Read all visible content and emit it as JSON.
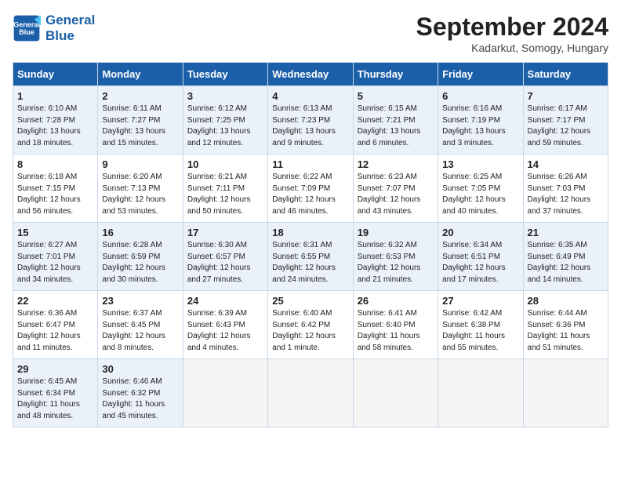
{
  "header": {
    "logo_line1": "General",
    "logo_line2": "Blue",
    "month_year": "September 2024",
    "location": "Kadarkut, Somogy, Hungary"
  },
  "weekdays": [
    "Sunday",
    "Monday",
    "Tuesday",
    "Wednesday",
    "Thursday",
    "Friday",
    "Saturday"
  ],
  "weeks": [
    [
      {
        "day": "1",
        "sunrise": "6:10 AM",
        "sunset": "7:28 PM",
        "daylight": "13 hours and 18 minutes."
      },
      {
        "day": "2",
        "sunrise": "6:11 AM",
        "sunset": "7:27 PM",
        "daylight": "13 hours and 15 minutes."
      },
      {
        "day": "3",
        "sunrise": "6:12 AM",
        "sunset": "7:25 PM",
        "daylight": "13 hours and 12 minutes."
      },
      {
        "day": "4",
        "sunrise": "6:13 AM",
        "sunset": "7:23 PM",
        "daylight": "13 hours and 9 minutes."
      },
      {
        "day": "5",
        "sunrise": "6:15 AM",
        "sunset": "7:21 PM",
        "daylight": "13 hours and 6 minutes."
      },
      {
        "day": "6",
        "sunrise": "6:16 AM",
        "sunset": "7:19 PM",
        "daylight": "13 hours and 3 minutes."
      },
      {
        "day": "7",
        "sunrise": "6:17 AM",
        "sunset": "7:17 PM",
        "daylight": "12 hours and 59 minutes."
      }
    ],
    [
      {
        "day": "8",
        "sunrise": "6:18 AM",
        "sunset": "7:15 PM",
        "daylight": "12 hours and 56 minutes."
      },
      {
        "day": "9",
        "sunrise": "6:20 AM",
        "sunset": "7:13 PM",
        "daylight": "12 hours and 53 minutes."
      },
      {
        "day": "10",
        "sunrise": "6:21 AM",
        "sunset": "7:11 PM",
        "daylight": "12 hours and 50 minutes."
      },
      {
        "day": "11",
        "sunrise": "6:22 AM",
        "sunset": "7:09 PM",
        "daylight": "12 hours and 46 minutes."
      },
      {
        "day": "12",
        "sunrise": "6:23 AM",
        "sunset": "7:07 PM",
        "daylight": "12 hours and 43 minutes."
      },
      {
        "day": "13",
        "sunrise": "6:25 AM",
        "sunset": "7:05 PM",
        "daylight": "12 hours and 40 minutes."
      },
      {
        "day": "14",
        "sunrise": "6:26 AM",
        "sunset": "7:03 PM",
        "daylight": "12 hours and 37 minutes."
      }
    ],
    [
      {
        "day": "15",
        "sunrise": "6:27 AM",
        "sunset": "7:01 PM",
        "daylight": "12 hours and 34 minutes."
      },
      {
        "day": "16",
        "sunrise": "6:28 AM",
        "sunset": "6:59 PM",
        "daylight": "12 hours and 30 minutes."
      },
      {
        "day": "17",
        "sunrise": "6:30 AM",
        "sunset": "6:57 PM",
        "daylight": "12 hours and 27 minutes."
      },
      {
        "day": "18",
        "sunrise": "6:31 AM",
        "sunset": "6:55 PM",
        "daylight": "12 hours and 24 minutes."
      },
      {
        "day": "19",
        "sunrise": "6:32 AM",
        "sunset": "6:53 PM",
        "daylight": "12 hours and 21 minutes."
      },
      {
        "day": "20",
        "sunrise": "6:34 AM",
        "sunset": "6:51 PM",
        "daylight": "12 hours and 17 minutes."
      },
      {
        "day": "21",
        "sunrise": "6:35 AM",
        "sunset": "6:49 PM",
        "daylight": "12 hours and 14 minutes."
      }
    ],
    [
      {
        "day": "22",
        "sunrise": "6:36 AM",
        "sunset": "6:47 PM",
        "daylight": "12 hours and 11 minutes."
      },
      {
        "day": "23",
        "sunrise": "6:37 AM",
        "sunset": "6:45 PM",
        "daylight": "12 hours and 8 minutes."
      },
      {
        "day": "24",
        "sunrise": "6:39 AM",
        "sunset": "6:43 PM",
        "daylight": "12 hours and 4 minutes."
      },
      {
        "day": "25",
        "sunrise": "6:40 AM",
        "sunset": "6:42 PM",
        "daylight": "12 hours and 1 minute."
      },
      {
        "day": "26",
        "sunrise": "6:41 AM",
        "sunset": "6:40 PM",
        "daylight": "11 hours and 58 minutes."
      },
      {
        "day": "27",
        "sunrise": "6:42 AM",
        "sunset": "6:38 PM",
        "daylight": "11 hours and 55 minutes."
      },
      {
        "day": "28",
        "sunrise": "6:44 AM",
        "sunset": "6:36 PM",
        "daylight": "11 hours and 51 minutes."
      }
    ],
    [
      {
        "day": "29",
        "sunrise": "6:45 AM",
        "sunset": "6:34 PM",
        "daylight": "11 hours and 48 minutes."
      },
      {
        "day": "30",
        "sunrise": "6:46 AM",
        "sunset": "6:32 PM",
        "daylight": "11 hours and 45 minutes."
      },
      null,
      null,
      null,
      null,
      null
    ]
  ]
}
